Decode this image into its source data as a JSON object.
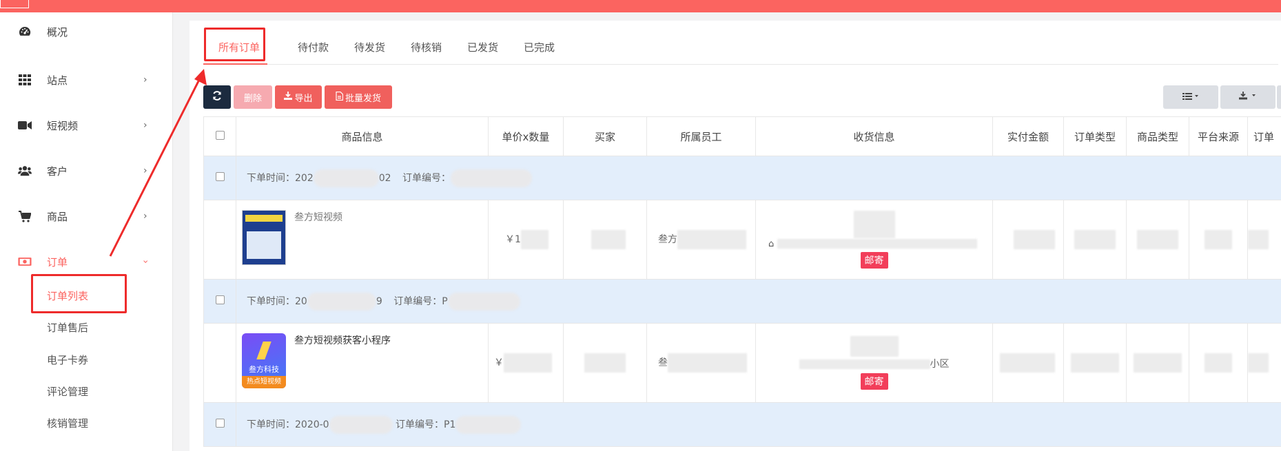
{
  "colors": {
    "accent": "#fb6460",
    "highlight_red": "#ee2b2b",
    "row_sep": "#e3eefb",
    "badge": "#f23e5a"
  },
  "sidebar": {
    "items": [
      {
        "label": "概况",
        "icon": "dashboard-icon"
      },
      {
        "label": "站点",
        "icon": "grid-icon"
      },
      {
        "label": "短视频",
        "icon": "video-camera-icon"
      },
      {
        "label": "客户",
        "icon": "users-icon"
      },
      {
        "label": "商品",
        "icon": "cart-icon"
      },
      {
        "label": "订单",
        "icon": "money-icon"
      }
    ],
    "sub_items": [
      {
        "label": "订单列表"
      },
      {
        "label": "订单售后"
      },
      {
        "label": "电子卡券"
      },
      {
        "label": "评论管理"
      },
      {
        "label": "核销管理"
      }
    ]
  },
  "tabs": [
    {
      "label": "所有订单"
    },
    {
      "label": "待付款"
    },
    {
      "label": "待发货"
    },
    {
      "label": "待核销"
    },
    {
      "label": "已发货"
    },
    {
      "label": "已完成"
    }
  ],
  "toolbar": {
    "refresh_icon": "refresh-icon",
    "delete_label": "删除",
    "export_label": "导出",
    "batch_ship_label": "批量发货"
  },
  "table": {
    "headers": [
      "商品信息",
      "单价x数量",
      "买家",
      "所属员工",
      "收货信息",
      "实付金额",
      "订单类型",
      "商品类型",
      "平台来源",
      "订单"
    ],
    "orders": [
      {
        "time_label": "下单时间：202",
        "time_tail": "02",
        "no_label": "订单编号：",
        "product_name": "叁方短视频",
        "price_prefix": "￥1",
        "staff_prefix": "叁方",
        "ship_badge": "邮寄"
      },
      {
        "time_label": "下单时间：20",
        "time_tail": "9",
        "no_label": "订单编号：",
        "no_tail": "P",
        "product_name": "叁方短视频获客小程序",
        "price_prefix": "￥",
        "staff_prefix": "叁",
        "ship_badge": "邮寄",
        "addr_tail": "小区",
        "thumb_title": "叁方科技",
        "thumb_sub": "热点短视频"
      },
      {
        "time_label": "下单时间：2020-0",
        "no_label": "订单编号：P1"
      }
    ]
  }
}
